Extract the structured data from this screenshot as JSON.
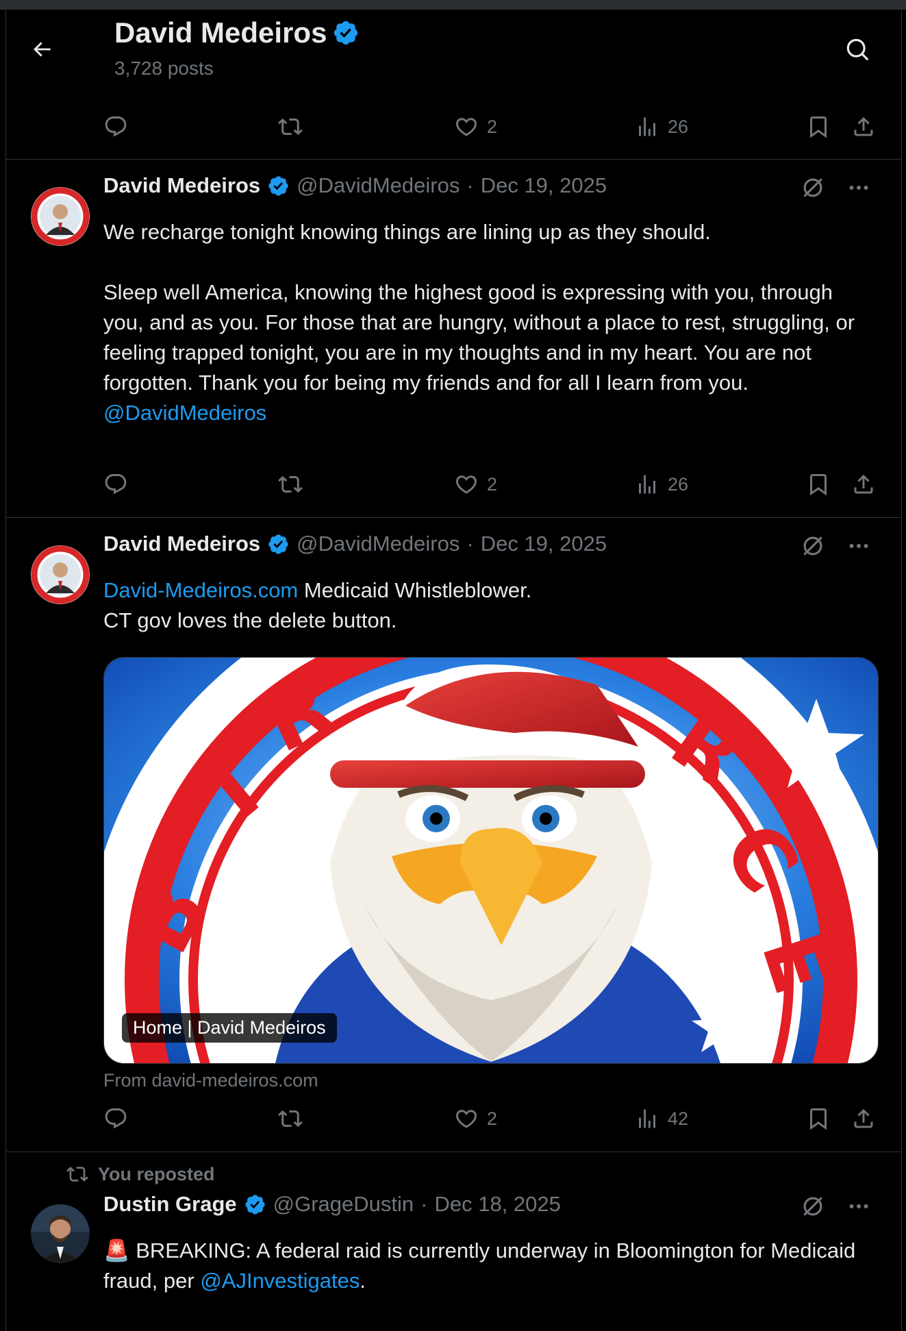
{
  "header": {
    "title": "David Medeiros",
    "posts_count": "3,728 posts"
  },
  "colors": {
    "background": "#000000",
    "accent": "#1d9bf0",
    "muted": "#71767b",
    "text": "#e7e9ea",
    "divider": "#2f3336"
  },
  "prev_tweet": {
    "likes": "2",
    "views": "26"
  },
  "tweets": [
    {
      "name": "David Medeiros",
      "handle": "@DavidMedeiros",
      "date": "Dec 19, 2025",
      "text_line1": "We recharge tonight knowing things are lining up as they should.",
      "text_para2": "Sleep well America, knowing the highest good is expressing with you, through you, and as you. For those that are hungry, without a place to rest, struggling, or feeling trapped tonight, you are in my thoughts and in my heart. You are not forgotten. Thank you for being my friends and for all I learn from you.",
      "mention": "@DavidMedeiros",
      "likes": "2",
      "views": "26"
    },
    {
      "name": "David Medeiros",
      "handle": "@DavidMedeiros",
      "date": "Dec 19, 2025",
      "link": "David-Medeiros.com",
      "text_after_link": " Medicaid Whistleblower.",
      "text_line2": "CT gov loves the delete button.",
      "card_label": "Home | David Medeiros",
      "card_from": "From david-medeiros.com",
      "likes": "2",
      "views": "42"
    },
    {
      "repost_label": "You reposted",
      "name": "Dustin Grage",
      "handle": "@GrageDustin",
      "date": "Dec 18, 2025",
      "siren": "🚨",
      "text_part1": " BREAKING: A federal raid is currently underway in Bloomington for Medicaid fraud, per ",
      "mention": "@AJInvestigates",
      "text_part2": "."
    }
  ],
  "separator": "·",
  "icons": [
    "back-arrow-icon",
    "search-icon",
    "verified-badge-icon",
    "reply-icon",
    "repost-icon",
    "like-icon",
    "views-icon",
    "bookmark-icon",
    "share-icon",
    "grok-icon",
    "more-icon"
  ]
}
